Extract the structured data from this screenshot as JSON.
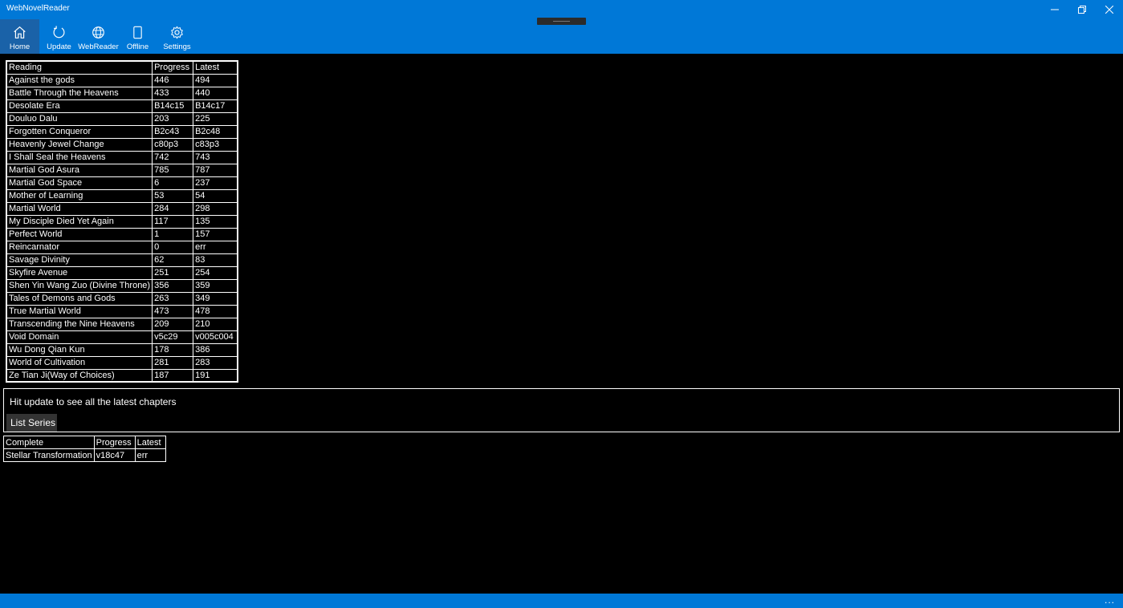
{
  "app": {
    "title": "WebNovelReader"
  },
  "nav": [
    {
      "label": "Home",
      "icon": "home-icon"
    },
    {
      "label": "Update",
      "icon": "refresh-icon"
    },
    {
      "label": "WebReader",
      "icon": "globe-icon"
    },
    {
      "label": "Offline",
      "icon": "tablet-icon"
    },
    {
      "label": "Settings",
      "icon": "gear-icon"
    }
  ],
  "reading": {
    "headers": [
      "Reading",
      "Progress",
      "Latest"
    ],
    "rows": [
      [
        "Against the gods",
        "446",
        "494"
      ],
      [
        "Battle Through the Heavens",
        "433",
        "440"
      ],
      [
        "Desolate Era",
        "B14c15",
        "B14c17"
      ],
      [
        "Douluo Dalu",
        "203",
        "225"
      ],
      [
        "Forgotten Conqueror",
        "B2c43",
        "B2c48"
      ],
      [
        "Heavenly Jewel Change",
        "c80p3",
        "c83p3"
      ],
      [
        "I Shall Seal the Heavens",
        "742",
        "743"
      ],
      [
        "Martial God Asura",
        "785",
        "787"
      ],
      [
        "Martial God Space",
        "6",
        "237"
      ],
      [
        "Mother of Learning",
        "53",
        "54"
      ],
      [
        "Martial World",
        "284",
        "298"
      ],
      [
        "My Disciple Died Yet Again",
        "117",
        "135"
      ],
      [
        "Perfect World",
        "1",
        "157"
      ],
      [
        "Reincarnator",
        "0",
        "err"
      ],
      [
        "Savage Divinity",
        "62",
        "83"
      ],
      [
        "Skyfire Avenue",
        "251",
        "254"
      ],
      [
        "Shen Yin Wang Zuo (Divine Throne)",
        "356",
        "359"
      ],
      [
        "Tales of Demons and Gods",
        "263",
        "349"
      ],
      [
        "True Martial World",
        "473",
        "478"
      ],
      [
        "Transcending the Nine Heavens",
        "209",
        "210"
      ],
      [
        "Void Domain",
        "v5c29",
        "v005c004"
      ],
      [
        "Wu Dong Qian Kun",
        "178",
        "386"
      ],
      [
        "World of Cultivation",
        "281",
        "283"
      ],
      [
        "Ze Tian Ji(Way of Choices)",
        "187",
        "191"
      ]
    ]
  },
  "info": {
    "message": "Hit update to see all the latest chapters",
    "list_button": "List Series"
  },
  "complete": {
    "headers": [
      "Complete",
      "Progress",
      "Latest"
    ],
    "rows": [
      [
        "Stellar Transformation",
        "v18c47",
        "err"
      ]
    ]
  },
  "statusbar": {
    "more": "..."
  },
  "colors": {
    "accent": "#0078d7",
    "active_nav": "#1a62a8",
    "background": "#000000"
  }
}
